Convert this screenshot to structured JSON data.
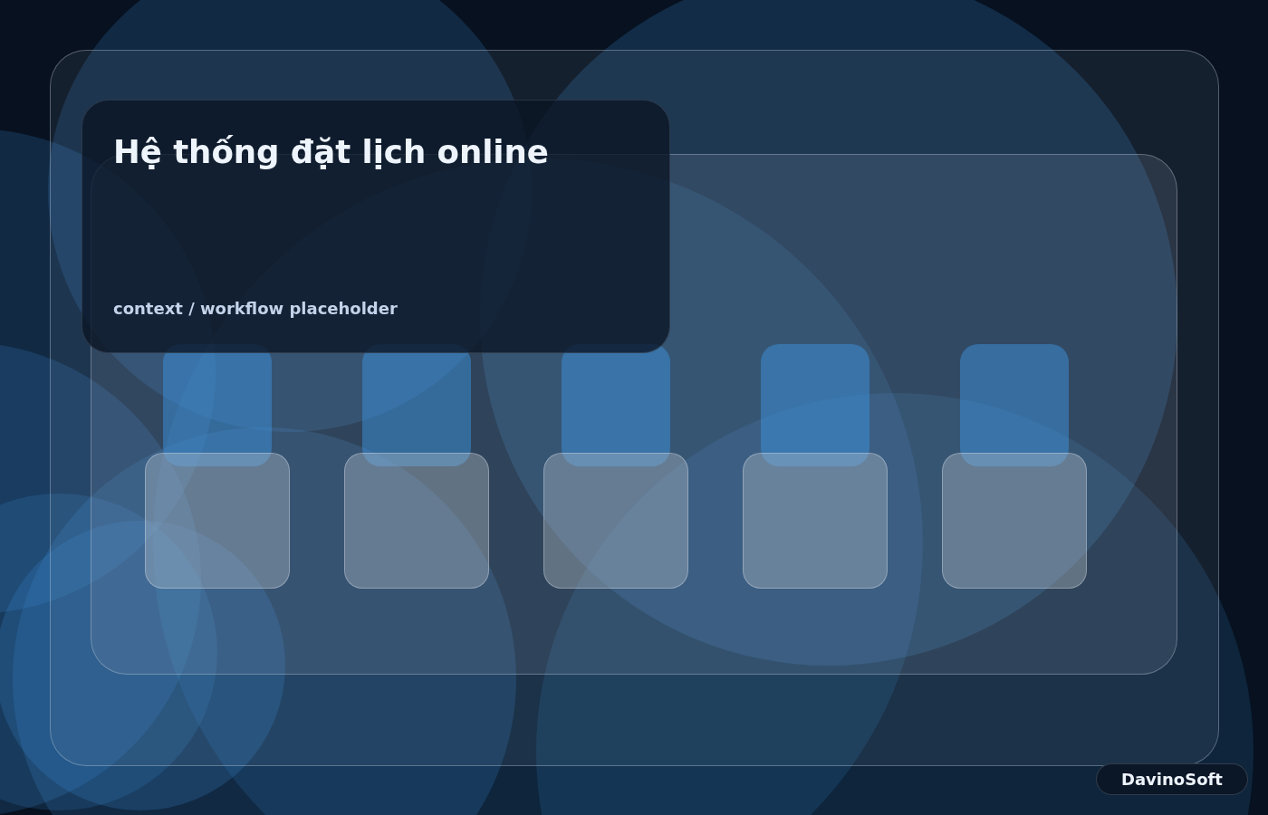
{
  "title_card": {
    "title": "Hệ thống đặt lịch online",
    "subtitle": "context / workflow placeholder"
  },
  "badge": {
    "label": "DavinoSoft"
  }
}
